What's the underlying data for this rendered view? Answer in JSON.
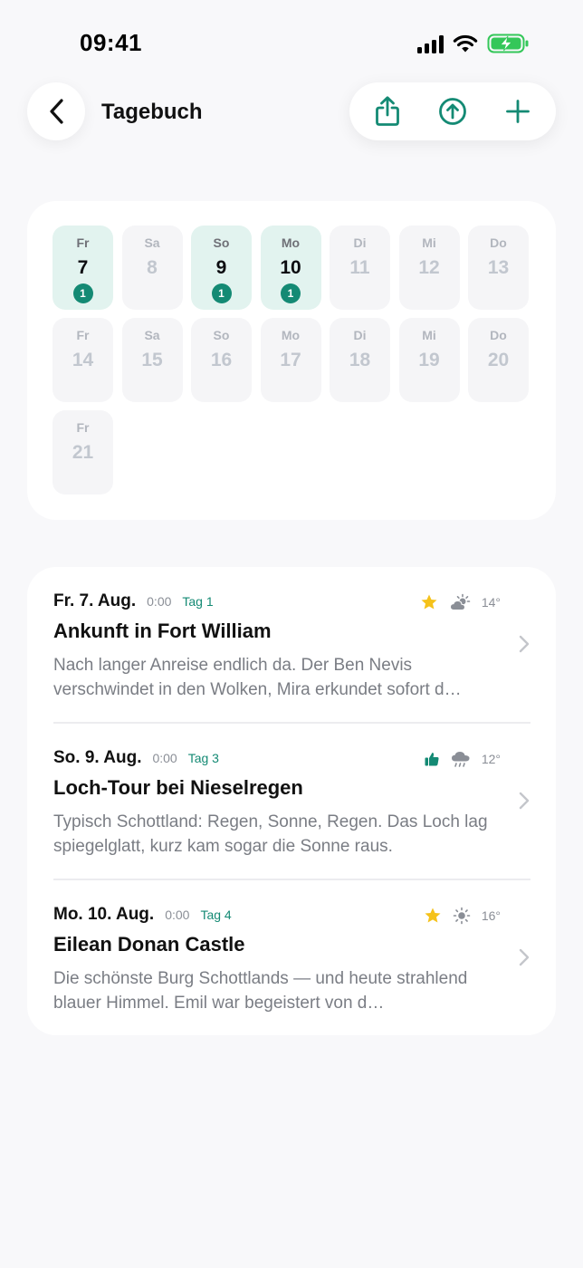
{
  "status_bar": {
    "time": "09:41"
  },
  "header": {
    "title": "Tagebuch"
  },
  "calendar": {
    "days": [
      {
        "abbr": "Fr",
        "num": "7",
        "count": "1"
      },
      {
        "abbr": "Sa",
        "num": "8",
        "count": ""
      },
      {
        "abbr": "So",
        "num": "9",
        "count": "1"
      },
      {
        "abbr": "Mo",
        "num": "10",
        "count": "1"
      },
      {
        "abbr": "Di",
        "num": "11",
        "count": ""
      },
      {
        "abbr": "Mi",
        "num": "12",
        "count": ""
      },
      {
        "abbr": "Do",
        "num": "13",
        "count": ""
      },
      {
        "abbr": "Fr",
        "num": "14",
        "count": ""
      },
      {
        "abbr": "Sa",
        "num": "15",
        "count": ""
      },
      {
        "abbr": "So",
        "num": "16",
        "count": ""
      },
      {
        "abbr": "Mo",
        "num": "17",
        "count": ""
      },
      {
        "abbr": "Di",
        "num": "18",
        "count": ""
      },
      {
        "abbr": "Mi",
        "num": "19",
        "count": ""
      },
      {
        "abbr": "Do",
        "num": "20",
        "count": ""
      },
      {
        "abbr": "Fr",
        "num": "21",
        "count": ""
      }
    ]
  },
  "entries": [
    {
      "date": "Fr. 7. Aug.",
      "time": "0:00",
      "tag": "Tag 1",
      "rating_icon": "star-icon",
      "weather_icon": "partly-cloudy-icon",
      "temp": "14°",
      "title": "Ankunft in Fort William",
      "text": "Nach langer Anreise endlich da. Der Ben Nevis verschwindet in den Wolken, Mira erkundet sofort d…"
    },
    {
      "date": "So. 9. Aug.",
      "time": "0:00",
      "tag": "Tag 3",
      "rating_icon": "thumbs-up-icon",
      "weather_icon": "rain-cloud-icon",
      "temp": "12°",
      "title": "Loch-Tour bei Nieselregen",
      "text": "Typisch Schottland: Regen, Sonne, Regen. Das Loch lag spiegelglatt, kurz kam sogar die Sonne raus."
    },
    {
      "date": "Mo. 10. Aug.",
      "time": "0:00",
      "tag": "Tag 4",
      "rating_icon": "star-icon",
      "weather_icon": "sun-icon",
      "temp": "16°",
      "title": "Eilean Donan Castle",
      "text": "Die schönste Burg Schottlands — und heute strahlend blauer Himmel. Emil war begeistert von d…"
    }
  ],
  "colors": {
    "accent": "#148a74",
    "accent_light": "#e2f3ef",
    "star": "#f5c21b",
    "battery": "#34c759"
  }
}
